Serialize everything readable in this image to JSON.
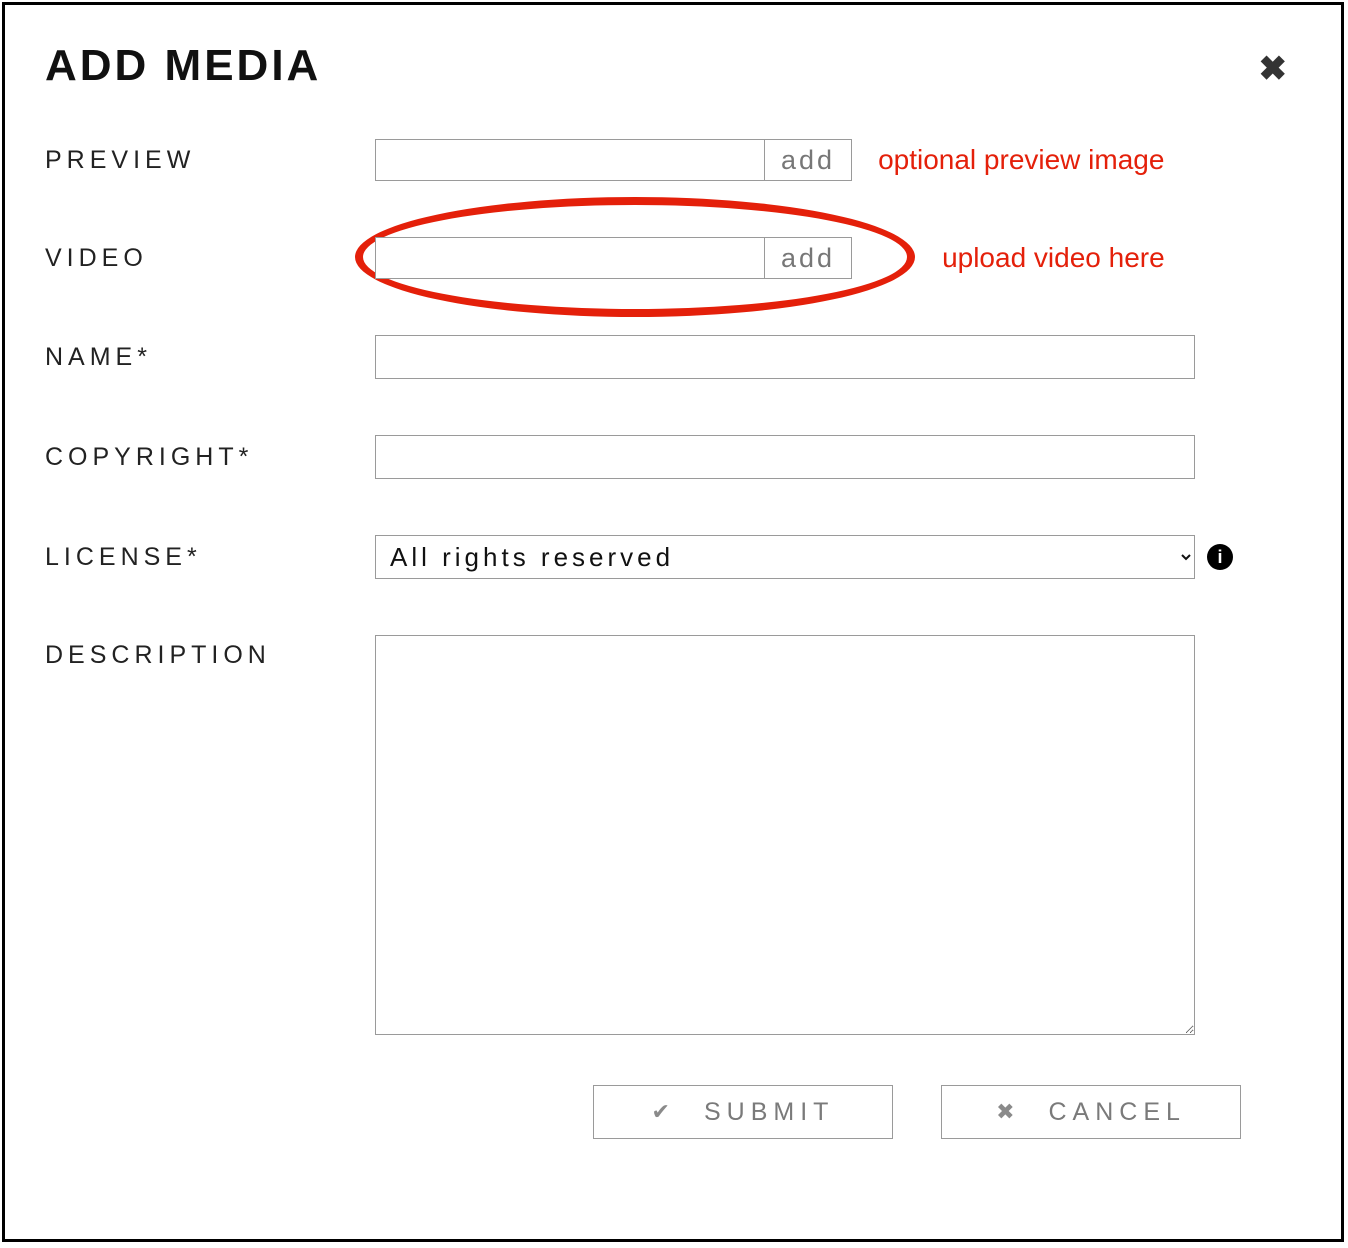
{
  "modal": {
    "title": "ADD MEDIA",
    "rows": {
      "preview": {
        "label": "PREVIEW",
        "add_label": "add",
        "annotation": "optional preview image",
        "value": ""
      },
      "video": {
        "label": "VIDEO",
        "add_label": "add",
        "annotation": "upload video here",
        "value": ""
      },
      "name": {
        "label": "NAME*",
        "value": ""
      },
      "copyright": {
        "label": "COPYRIGHT*",
        "value": ""
      },
      "license": {
        "label": "LICENSE*",
        "selected": "All rights reserved"
      },
      "description": {
        "label": "DESCRIPTION",
        "value": ""
      }
    },
    "buttons": {
      "submit": "SUBMIT",
      "cancel": "CANCEL"
    }
  },
  "colors": {
    "annotation": "#e4200a"
  }
}
